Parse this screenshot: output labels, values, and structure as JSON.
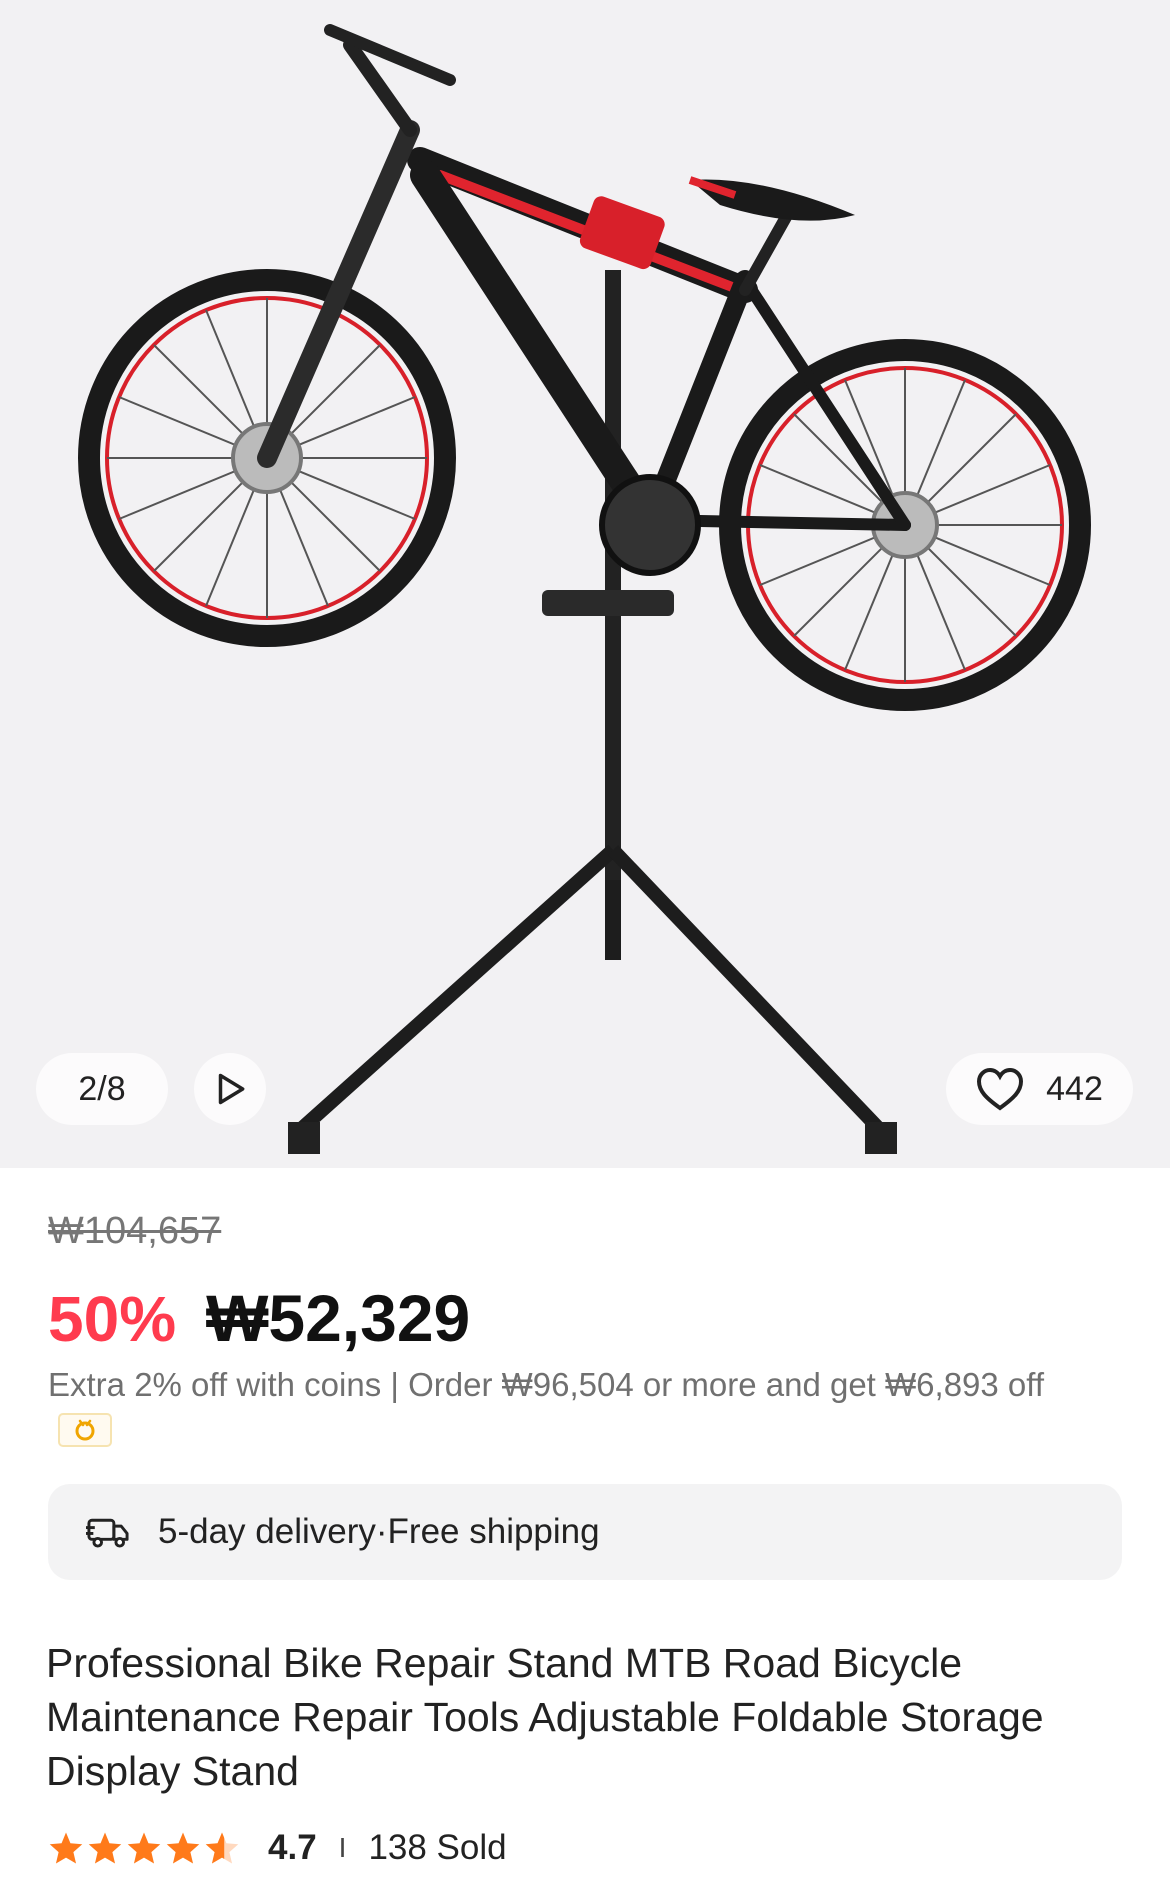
{
  "gallery": {
    "counter": "2/8",
    "favorites_count": "442",
    "image_icon": "bike-repair-stand-photo",
    "play_icon": "play-icon",
    "heart_icon": "heart-icon"
  },
  "pricing": {
    "original_price": "₩104,657",
    "discount": "50%",
    "price": "₩52,329",
    "promo_text": "Extra 2% off with coins | Order ₩96,504 or more and get ₩6,893 off",
    "coin_icon": "coin-icon"
  },
  "delivery": {
    "icon": "delivery-truck-icon",
    "text": "5-day delivery·Free shipping"
  },
  "product": {
    "title": "Professional Bike Repair Stand MTB Road Bicycle Maintenance Repair Tools Adjustable Foldable Storage Display Stand"
  },
  "rating": {
    "stars": 4.7,
    "value": "4.7",
    "separator": "I",
    "sold": "138 Sold"
  },
  "colors": {
    "accent_red": "#ff3b4e",
    "star_orange": "#ff7a1a",
    "gallery_bg": "#f2f1f3"
  }
}
